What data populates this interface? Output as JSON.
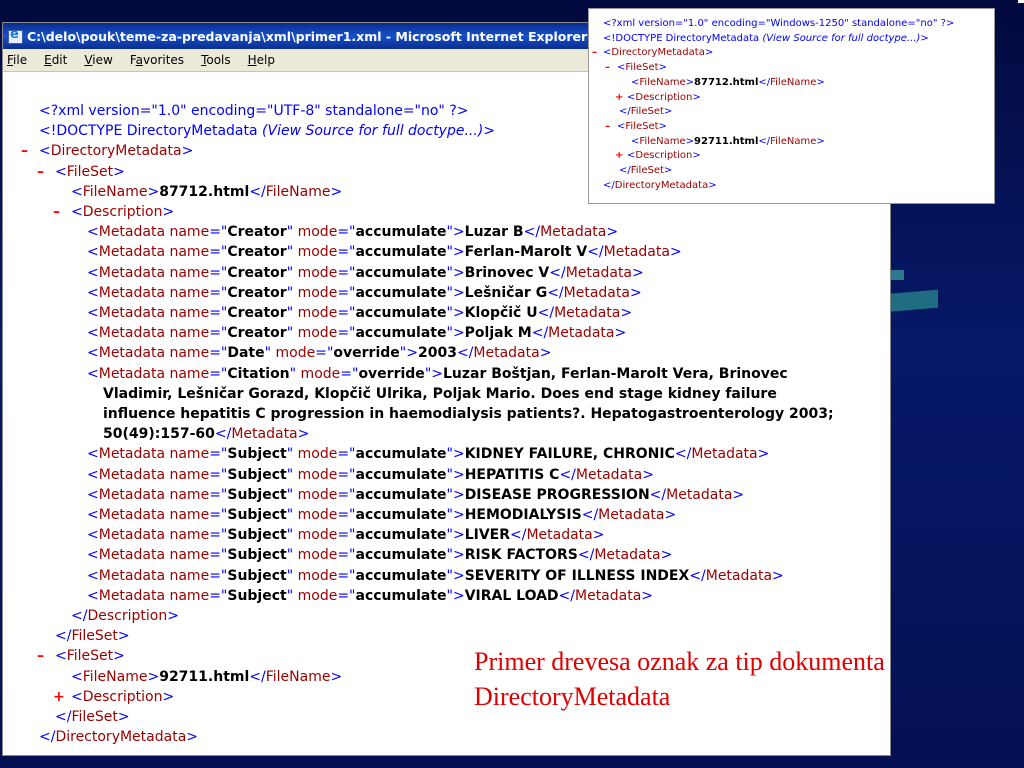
{
  "window": {
    "title": "C:\\delo\\pouk\\teme-za-predavanja\\xml\\primer1.xml - Microsoft Internet Explorer"
  },
  "menu": {
    "file": "File",
    "edit": "Edit",
    "view": "View",
    "favorites": "Favorites",
    "tools": "Tools",
    "help": "Help"
  },
  "xml": {
    "declaration": "<?xml version=\"1.0\" encoding=\"UTF-8\" standalone=\"no\" ?>",
    "doctype_prefix": "<!DOCTYPE DirectoryMetadata ",
    "doctype_note": "(View Source for full doctype...)",
    "doctype_suffix": ">",
    "root": "DirectoryMetadata",
    "fileset": "FileSet",
    "filename_tag": "FileName",
    "description": "Description",
    "metadata_tag": "Metadata",
    "name_attr": "name",
    "mode_attr": "mode",
    "fileset1_filename": "87712.html",
    "fileset2_filename": "92711.html",
    "metadata": [
      {
        "name": "Creator",
        "mode": "accumulate",
        "value": "Luzar B"
      },
      {
        "name": "Creator",
        "mode": "accumulate",
        "value": "Ferlan-Marolt V"
      },
      {
        "name": "Creator",
        "mode": "accumulate",
        "value": "Brinovec V"
      },
      {
        "name": "Creator",
        "mode": "accumulate",
        "value": "Lešničar G"
      },
      {
        "name": "Creator",
        "mode": "accumulate",
        "value": "Klopčič U"
      },
      {
        "name": "Creator",
        "mode": "accumulate",
        "value": "Poljak M"
      },
      {
        "name": "Date",
        "mode": "override",
        "value": "2003"
      },
      {
        "name": "Citation",
        "mode": "override",
        "value": "Luzar Boštjan, Ferlan-Marolt Vera, Brinovec Vladimir, Lešničar Gorazd, Klopčič Ulrika, Poljak Mario. Does end stage kidney failure influence hepatitis C progression in haemodialysis patients?. Hepatogastroenterology 2003; 50(49):157-60"
      },
      {
        "name": "Subject",
        "mode": "accumulate",
        "value": "KIDNEY FAILURE, CHRONIC"
      },
      {
        "name": "Subject",
        "mode": "accumulate",
        "value": "HEPATITIS C"
      },
      {
        "name": "Subject",
        "mode": "accumulate",
        "value": "DISEASE PROGRESSION"
      },
      {
        "name": "Subject",
        "mode": "accumulate",
        "value": "HEMODIALYSIS"
      },
      {
        "name": "Subject",
        "mode": "accumulate",
        "value": "LIVER"
      },
      {
        "name": "Subject",
        "mode": "accumulate",
        "value": "RISK FACTORS"
      },
      {
        "name": "Subject",
        "mode": "accumulate",
        "value": "SEVERITY OF ILLNESS INDEX"
      },
      {
        "name": "Subject",
        "mode": "accumulate",
        "value": "VIRAL LOAD"
      }
    ],
    "toggle_minus": "–",
    "toggle_plus": "+"
  },
  "inset": {
    "declaration": "<?xml version=\"1.0\" encoding=\"Windows-1250\" standalone=\"no\" ?>",
    "doctype_prefix": "<!DOCTYPE DirectoryMetadata ",
    "doctype_note": "(View Source for full doctype...)",
    "doctype_suffix": ">",
    "fileset1_filename": "87712.html",
    "fileset2_filename": "92711.html"
  },
  "caption": {
    "line1": "Primer drevesa oznak za tip dokumenta",
    "line2": "DirectoryMetadata"
  },
  "colors": {
    "background": "#041052",
    "caption": "#e00000",
    "tag": "#990000",
    "bracket": "#0000ff",
    "toggle": "#ff0000"
  }
}
